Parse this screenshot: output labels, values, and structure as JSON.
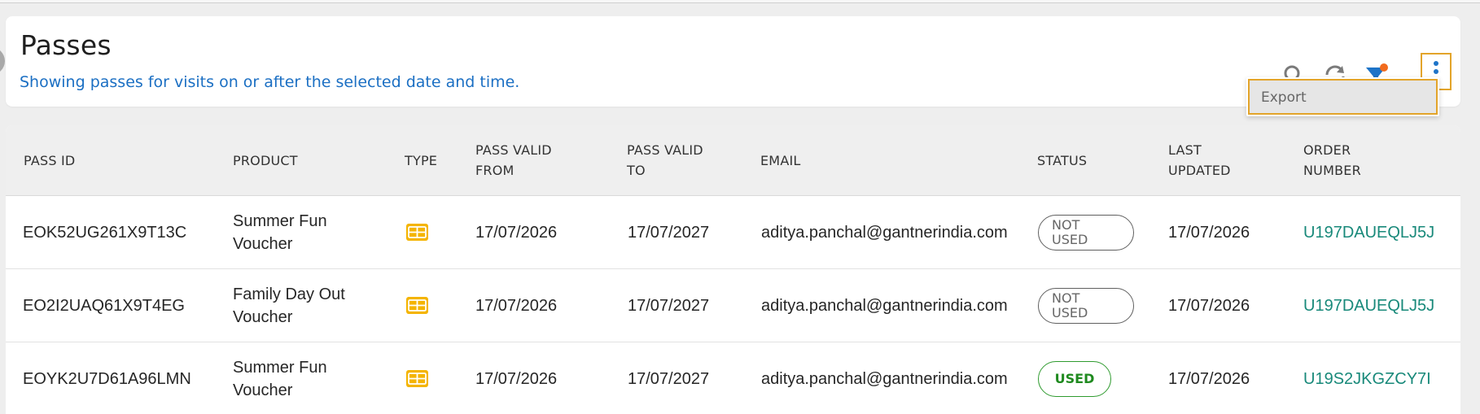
{
  "header": {
    "title": "Passes",
    "subtitle": "Showing passes for visits on or after the selected date and time."
  },
  "toolbar": {
    "icons": [
      "search-icon",
      "refresh-icon",
      "filter-icon",
      "more-vertical-icon"
    ],
    "filter_active_dot_color": "#f26b1d",
    "menu": {
      "export_label": "Export"
    }
  },
  "colors": {
    "accent_blue": "#1b6fc3",
    "icon_gray": "#7a7a7a",
    "icon_blue": "#1e74c8",
    "highlight_orange": "#e3a42a",
    "type_icon_yellow": "#f4b400",
    "used_green": "#1f8a1f",
    "link_teal": "#18897a"
  },
  "table": {
    "columns": [
      "PASS ID",
      "PRODUCT",
      "TYPE",
      "PASS VALID\nFROM",
      "PASS VALID\nTO",
      "EMAIL",
      "STATUS",
      "LAST\nUPDATED",
      "ORDER\nNUMBER"
    ],
    "rows": [
      {
        "pass_id": "EOK52UG261X9T13C",
        "product": "Summer Fun Voucher",
        "type_icon": "voucher-ticket-icon",
        "valid_from": "17/07/2026",
        "valid_to": "17/07/2027",
        "email": "aditya.panchal@gantnerindia.com",
        "status": "NOT\nUSED",
        "last_updated": "17/07/2026",
        "order_number": "U197DAUEQLJ5J"
      },
      {
        "pass_id": "EO2I2UAQ61X9T4EG",
        "product": "Family Day Out Voucher",
        "type_icon": "voucher-ticket-icon",
        "valid_from": "17/07/2026",
        "valid_to": "17/07/2027",
        "email": "aditya.panchal@gantnerindia.com",
        "status": "NOT\nUSED",
        "last_updated": "17/07/2026",
        "order_number": "U197DAUEQLJ5J"
      },
      {
        "pass_id": "EOYK2U7D61A96LMN",
        "product": "Summer Fun Voucher",
        "type_icon": "voucher-ticket-icon",
        "valid_from": "17/07/2026",
        "valid_to": "17/07/2027",
        "email": "aditya.panchal@gantnerindia.com",
        "status": "USED",
        "last_updated": "17/07/2026",
        "order_number": "U19S2JKGZCY7I"
      }
    ]
  }
}
